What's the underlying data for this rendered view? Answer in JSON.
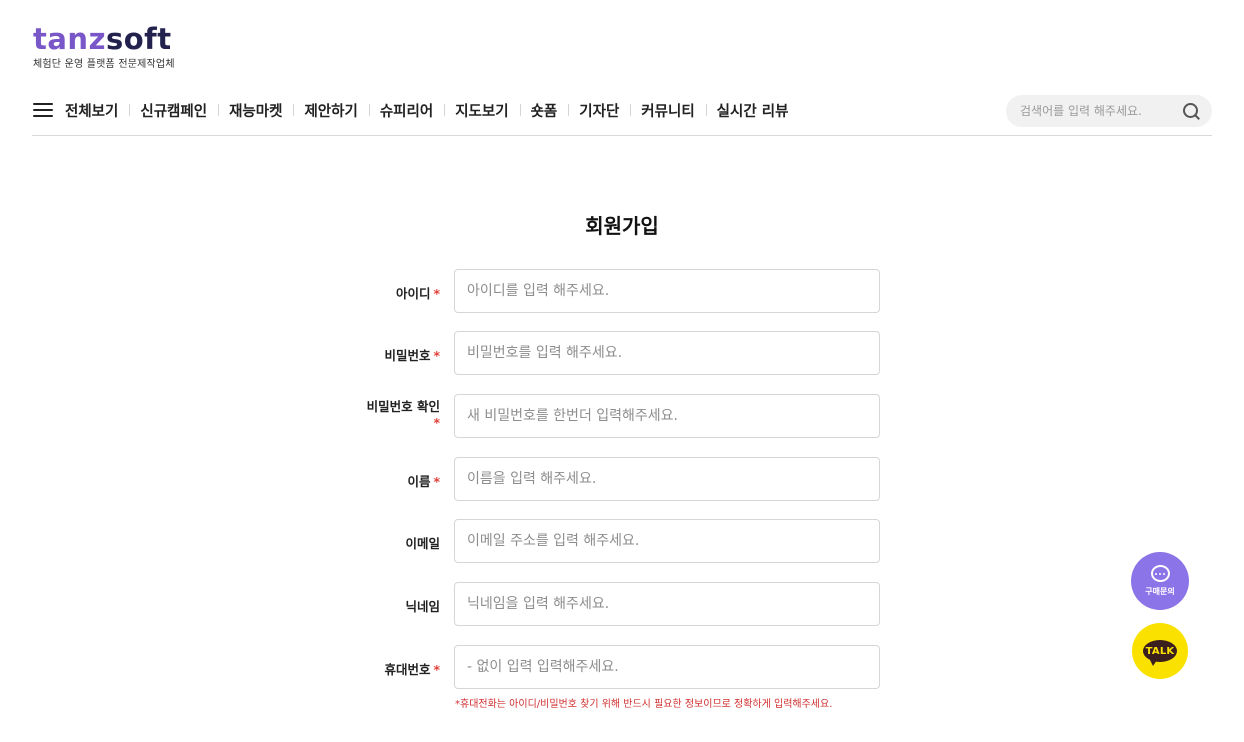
{
  "brand": {
    "logo_part1": "tanz",
    "logo_part2": "soft",
    "tagline": "체험단 운영 플랫폼 전문제작업체",
    "colors": {
      "primary_purple": "#7a57c9",
      "navy": "#23214e"
    }
  },
  "nav": {
    "menu_icon": "hamburger-menu-icon",
    "items": [
      "전체보기",
      "신규캠페인",
      "재능마켓",
      "제안하기",
      "슈피리어",
      "지도보기",
      "숏폼",
      "기자단",
      "커뮤니티",
      "실시간 리뷰"
    ]
  },
  "search": {
    "placeholder": "검색어를 입력 해주세요.",
    "icon": "search-icon"
  },
  "page": {
    "title": "회원가입"
  },
  "form": {
    "required_mark": "*",
    "fields": [
      {
        "label": "아이디",
        "placeholder": "아이디를 입력 해주세요.",
        "required": true
      },
      {
        "label": "비밀번호",
        "placeholder": "비밀번호를 입력 해주세요.",
        "required": true
      },
      {
        "label": "비밀번호 확인",
        "placeholder": "새 비밀번호를 한번더 입력해주세요.",
        "required": true
      },
      {
        "label": "이름",
        "placeholder": "이름을 입력 해주세요.",
        "required": true
      },
      {
        "label": "이메일",
        "placeholder": "이메일 주소를 입력 해주세요.",
        "required": false
      },
      {
        "label": "닉네임",
        "placeholder": "닉네임을 입력 해주세요.",
        "required": false
      },
      {
        "label": "휴대번호",
        "placeholder": "- 없이 입력 입력해주세요.",
        "required": true
      }
    ],
    "phone_helper": "*휴대전화는 아이디/비밀번호 찾기 위해 반드시 필요한 정보이므로 정확하게 입력해주세요."
  },
  "floating": {
    "inquiry_label": "구매문의",
    "inquiry_icon": "chat-bubble-icon",
    "inquiry_color": "#8b73e8",
    "talk_label": "TALK",
    "talk_color": "#fae100"
  }
}
